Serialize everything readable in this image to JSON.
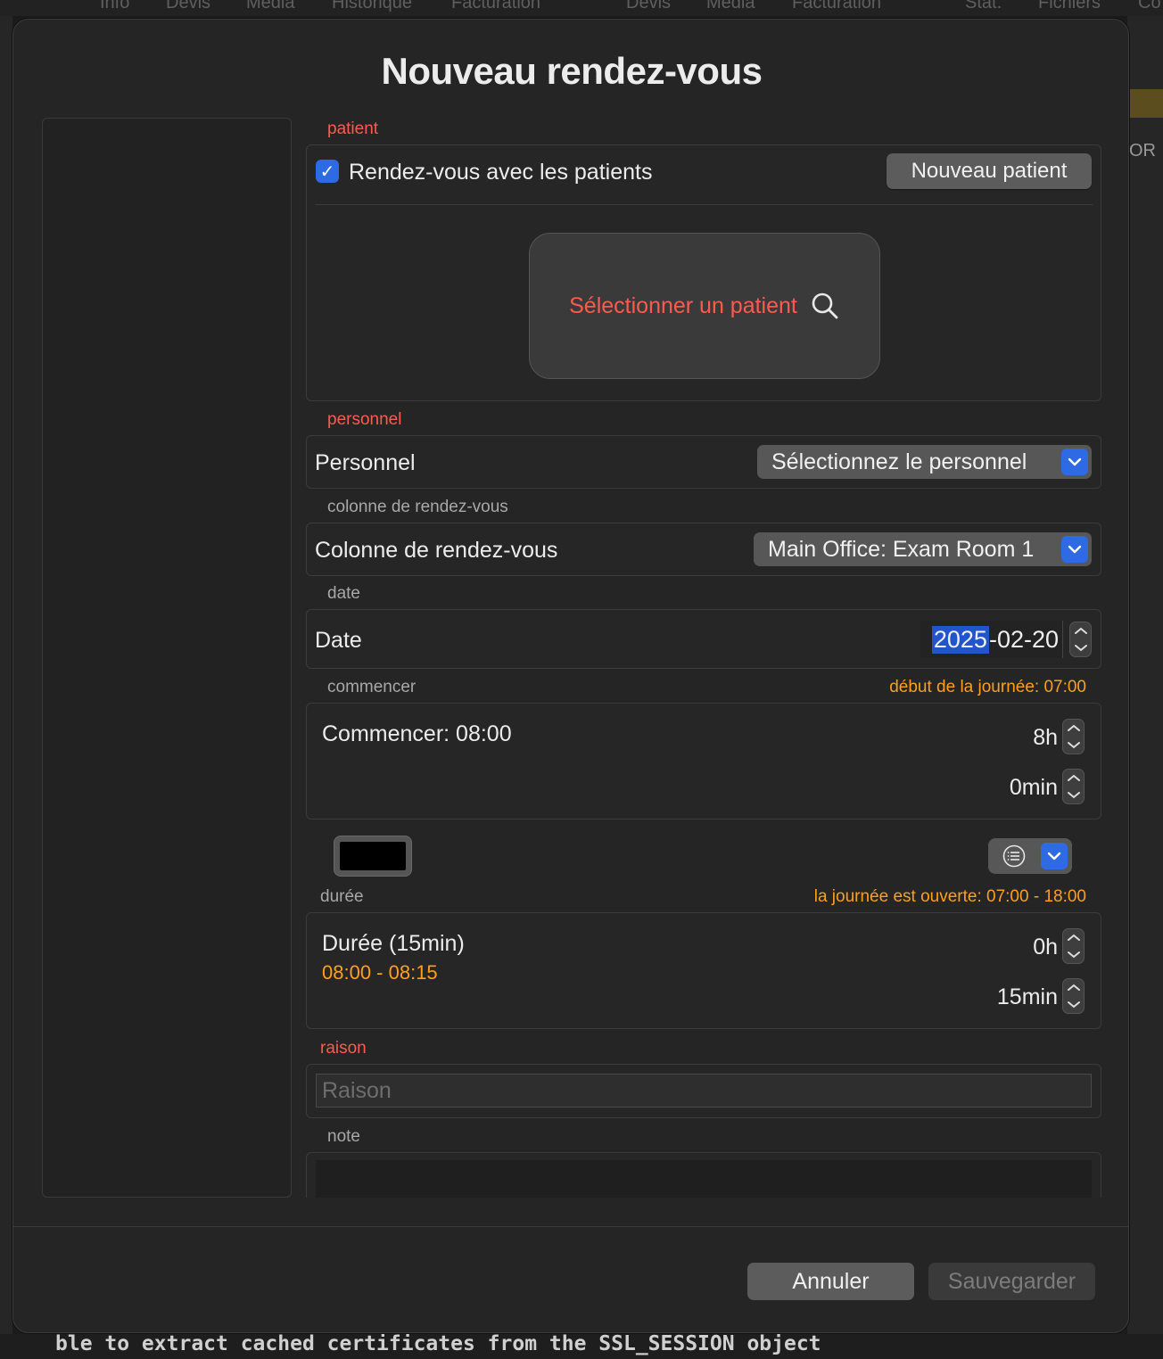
{
  "background": {
    "tabs": [
      "Info",
      "Devis",
      "Media",
      "Historique",
      "Facturation",
      "Devis",
      "Media",
      "Facturation",
      "Stat.",
      "Fichiers",
      "Co"
    ],
    "right_label": "OR",
    "console_text": "ble to extract cached certificates from the SSL_SESSION object"
  },
  "modal": {
    "title": "Nouveau rendez-vous"
  },
  "patient": {
    "section_label": "patient",
    "checkbox_label": "Rendez-vous avec les patients",
    "checkbox_checked": true,
    "new_patient_label": "Nouveau patient",
    "select_label": "Sélectionner un patient"
  },
  "personnel": {
    "section_label": "personnel",
    "row_label": "Personnel",
    "selected": "Sélectionnez le personnel"
  },
  "column": {
    "section_label": "colonne de rendez-vous",
    "row_label": "Colonne de rendez-vous",
    "selected": "Main Office: Exam Room 1"
  },
  "date": {
    "section_label": "date",
    "row_label": "Date",
    "year": "2025",
    "rest": "-02-20"
  },
  "start": {
    "section_label": "commencer",
    "day_start_note": "début de la journée: 07:00",
    "label": "Commencer: 08:00",
    "hours": "8h",
    "minutes": "0min"
  },
  "duration": {
    "section_label": "durée",
    "open_hours_note": "la journée est ouverte: 07:00 - 18:00",
    "label": "Durée (15min)",
    "range": "08:00 - 08:15",
    "hours": "0h",
    "minutes": "15min"
  },
  "reason": {
    "section_label": "raison",
    "placeholder": "Raison"
  },
  "note": {
    "section_label": "note"
  },
  "footer": {
    "cancel_label": "Annuler",
    "save_label": "Sauvegarder"
  },
  "colors": {
    "accent_blue": "#2f6ae5",
    "label_red": "#ff5a4e",
    "note_orange": "#ff9f1a",
    "appointment_color": "#000000"
  }
}
